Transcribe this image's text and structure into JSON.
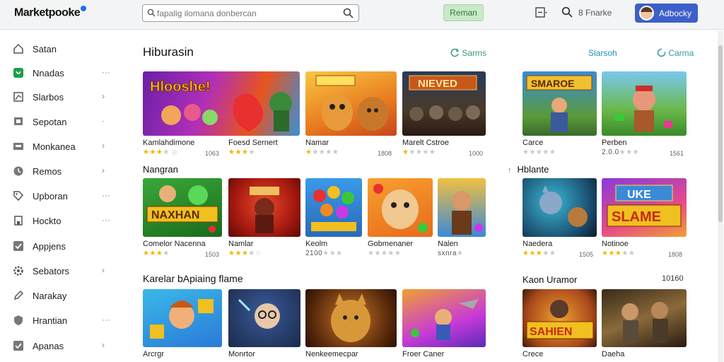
{
  "header": {
    "logo": "Marketpooke",
    "search_placeholder": "fapalig ilomana donbercan",
    "green_button": "Reman",
    "search_label": "8 Fnarke",
    "account_button": "Adbocky"
  },
  "sidebar": {
    "items": [
      {
        "label": "Satan",
        "icon": "home-icon",
        "chev": ""
      },
      {
        "label": "Nnadas",
        "icon": "play-icon",
        "chev": "···"
      },
      {
        "label": "Slarbos",
        "icon": "chart-icon",
        "chev": "›"
      },
      {
        "label": "Sepotan",
        "icon": "monitor-icon",
        "chev": "·"
      },
      {
        "label": "Monkanea",
        "icon": "tablet-icon",
        "chev": "›"
      },
      {
        "label": "Remos",
        "icon": "clock-icon",
        "chev": "›"
      },
      {
        "label": "Upboran",
        "icon": "tag-icon",
        "chev": "···"
      },
      {
        "label": "Hockto",
        "icon": "building-icon",
        "chev": "···"
      },
      {
        "label": "Appjens",
        "icon": "check-icon",
        "chev": ""
      },
      {
        "label": "Sebators",
        "icon": "gear-icon",
        "chev": "›"
      },
      {
        "label": "Narakay",
        "icon": "pencil-icon",
        "chev": ""
      },
      {
        "label": "Hrantian",
        "icon": "shield-icon",
        "chev": "···"
      },
      {
        "label": "Apanas",
        "icon": "check-box-icon",
        "chev": "›"
      }
    ]
  },
  "sections": {
    "main_title": "Hiburasin",
    "games_link": "Sarms",
    "slarsoh_link": "Slarsoh",
    "carma_link": "Carma",
    "nangran": "Nangran",
    "hblante": "Hblante",
    "karelar": "Karelar bApiaing flame",
    "kaon": "Kaon Uramor",
    "kaon_count": "10160"
  },
  "rows": {
    "row1": [
      {
        "name": "Kamlahdimone",
        "stars": 3,
        "count": "1063",
        "icon": "gamepad-icon"
      },
      {
        "name": "Foesd Sernert",
        "stars": 3,
        "count": ""
      },
      {
        "name": "Namar",
        "stars": 1,
        "count": "1808"
      },
      {
        "name": "Marelt Cstroe",
        "stars": 1,
        "count": "1000"
      },
      {
        "name": "Carce",
        "stars": 0,
        "count": ""
      },
      {
        "name": "Perben",
        "stars": 0,
        "count": "1561",
        "rating": "2.0.0"
      }
    ],
    "row2": [
      {
        "name": "Comelor Nacenna",
        "stars": 3,
        "count": "1503"
      },
      {
        "name": "Namlar",
        "stars": 3,
        "count": ""
      },
      {
        "name": "Keolm",
        "stars": 1,
        "count": "",
        "rating": "2100"
      },
      {
        "name": "Gobmenaner",
        "stars": 0,
        "count": ""
      },
      {
        "name": "Nalen",
        "stars": 0,
        "count": "",
        "rating": "sxnra"
      },
      {
        "name": "Naedera",
        "stars": 3,
        "count": "1505"
      },
      {
        "name": "Notinoe",
        "stars": 3,
        "count": "1808"
      }
    ],
    "row3": [
      {
        "name": "Arcrgr",
        "stars": 0,
        "count": ""
      },
      {
        "name": "Monrtor",
        "stars": 0,
        "count": ""
      },
      {
        "name": "Nenkeemecpar",
        "stars": 0,
        "count": ""
      },
      {
        "name": "Froer Caner",
        "stars": 0,
        "count": ""
      },
      {
        "name": "Crece",
        "stars": 0,
        "count": ""
      },
      {
        "name": "Daeha",
        "stars": 0,
        "count": ""
      }
    ]
  },
  "colors": {
    "accent": "#3d5fc9",
    "green": "#2e7d32",
    "star": "#f4b400"
  }
}
